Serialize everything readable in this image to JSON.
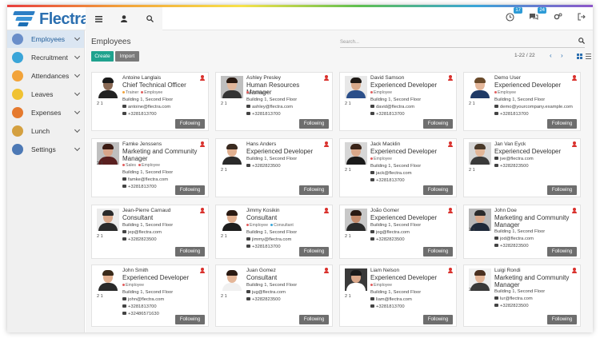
{
  "app": {
    "name": "Flectra"
  },
  "topbar": {
    "badges": {
      "activities": "17",
      "messages": "24"
    }
  },
  "sidebar": {
    "items": [
      {
        "label": "Employees",
        "color": "#6a8ec9"
      },
      {
        "label": "Recruitment",
        "color": "#3aa5d8"
      },
      {
        "label": "Attendances",
        "color": "#f2a33a"
      },
      {
        "label": "Leaves",
        "color": "#f0c232"
      },
      {
        "label": "Expenses",
        "color": "#e57a2e"
      },
      {
        "label": "Lunch",
        "color": "#d4a040"
      },
      {
        "label": "Settings",
        "color": "#4d79b5"
      }
    ]
  },
  "main": {
    "title": "Employees",
    "search_placeholder": "Search...",
    "create_label": "Create",
    "import_label": "Import",
    "pager": "1-22 / 22",
    "follow_label": "Following"
  },
  "accent": {
    "primary": "#1fa28e",
    "link": "#2b6fb0",
    "alert": "#d9302c"
  },
  "employees": [
    {
      "name": "Antoine Langlais",
      "title": "Chief Technical Officer",
      "tags": [
        [
          "Trainer",
          "#f2a33a"
        ],
        [
          "Employee",
          "#e05d5d"
        ]
      ],
      "building": "Building 1, Second Floor",
      "email": "antoine@flectra.com",
      "phone": "+3281813700",
      "extra": "",
      "stats": "2  1",
      "skin": "#8a6a55",
      "hair": "#1a1a1a",
      "shirt": "#222",
      "bg": "#ffffff"
    },
    {
      "name": "Ashley Presley",
      "title": "Human Resources Manager",
      "tags": [
        [
          "Employee",
          "#e05d5d"
        ]
      ],
      "building": "Building 1, Second Floor",
      "email": "ashley@flectra.com",
      "phone": "+3281813700",
      "extra": "",
      "stats": "2  1",
      "skin": "#e1b69a",
      "hair": "#2a1a12",
      "shirt": "#333",
      "bg": "#bfbfbf"
    },
    {
      "name": "David Samson",
      "title": "Experienced Developer",
      "tags": [
        [
          "Employee",
          "#e05d5d"
        ]
      ],
      "building": "Building 1, Second Floor",
      "email": "david@flectra.com",
      "phone": "+3281813700",
      "extra": "",
      "stats": "2  1",
      "skin": "#d7a98a",
      "hair": "#1f1a16",
      "shirt": "#2b4f8a",
      "bg": "#e8e8e8"
    },
    {
      "name": "Demo User",
      "title": "Experienced Developer",
      "tags": [
        [
          "Employee",
          "#e05d5d"
        ]
      ],
      "building": "Building 1, Second Floor",
      "email": "demo@yourcompany.example.com",
      "phone": "+3281813700",
      "extra": "",
      "stats": "2  1",
      "skin": "#e4b79a",
      "hair": "#6a4a2a",
      "shirt": "#1f3a66",
      "bg": "#ffffff"
    },
    {
      "name": "Famke Jenssens",
      "title": "Marketing and Community Manager",
      "tags": [
        [
          "Sales",
          "#e05d5d"
        ],
        [
          "Employee",
          "#e05d5d"
        ]
      ],
      "building": "Building 1, Second Floor",
      "email": "famke@flectra.com",
      "phone": "+3281813700",
      "extra": "",
      "stats": "2  1",
      "skin": "#d8a58a",
      "hair": "#3a1a12",
      "shirt": "#5a2020",
      "bg": "#bfbfbf"
    },
    {
      "name": "Hans Anders",
      "title": "Experienced Developer",
      "tags": [],
      "building": "Building 1, Second Floor",
      "email": "",
      "phone": "+3282823500",
      "extra": "",
      "stats": "2  1",
      "skin": "#e1b090",
      "hair": "#3a2a20",
      "shirt": "#2a2a2a",
      "bg": "#ffffff"
    },
    {
      "name": "Jack Macklin",
      "title": "Experienced Developer",
      "tags": [
        [
          "Employee",
          "#e05d5d"
        ]
      ],
      "building": "Building 1, Second Floor",
      "email": "jack@flectra.com",
      "phone": "+3281813700",
      "extra": "",
      "stats": "2  1",
      "skin": "#d9a88a",
      "hair": "#3a2418",
      "shirt": "#1a1a1a",
      "bg": "#d6d6d6"
    },
    {
      "name": "Jan Van Eyck",
      "title": "Experienced Developer",
      "tags": [],
      "building": "",
      "email": "jve@flectra.com",
      "phone": "+3282823500",
      "extra": "",
      "stats": "2  1",
      "skin": "#e2b698",
      "hair": "#4a3a2a",
      "shirt": "#3a3a3a",
      "bg": "#d8d8d8"
    },
    {
      "name": "Jean-Pierre Carnaud",
      "title": "Consultant",
      "tags": [],
      "building": "Building 1, Second Floor",
      "email": "jep@flectra.com",
      "phone": "+3282823500",
      "extra": "",
      "stats": "2  1",
      "skin": "#d9a88a",
      "hair": "#2a2a2a",
      "shirt": "#2a2a2a",
      "bg": "#ececec"
    },
    {
      "name": "Jimmy Kosikin",
      "title": "Consultant",
      "tags": [
        [
          "Employee",
          "#e05d5d"
        ],
        [
          "Consultant",
          "#3aa5d8"
        ]
      ],
      "building": "Building 1, Second Floor",
      "email": "jimmy@flectra.com",
      "phone": "+3281813700",
      "extra": "",
      "stats": "2  1",
      "skin": "#e1b090",
      "hair": "#2a1a12",
      "shirt": "#1e1e1e",
      "bg": "#ffffff"
    },
    {
      "name": "João Gomer",
      "title": "Experienced Developer",
      "tags": [],
      "building": "Building 1, Second Floor",
      "email": "jog@flectra.com",
      "phone": "+3282823500",
      "extra": "",
      "stats": "2  1",
      "skin": "#c48a6a",
      "hair": "#2a1a12",
      "shirt": "#2a2a2a",
      "bg": "#c8c8c8"
    },
    {
      "name": "John Doe",
      "title": "Marketing and Community Manager",
      "tags": [],
      "building": "Building 1, Second Floor",
      "email": "jod@flectra.com",
      "phone": "+3282823500",
      "extra": "",
      "stats": "2  1",
      "skin": "#d9a88a",
      "hair": "#2a2a2a",
      "shirt": "#1f2a3a",
      "bg": "#b8b8b8"
    },
    {
      "name": "John Smith",
      "title": "Experienced Developer",
      "tags": [
        [
          "Employee",
          "#e05d5d"
        ]
      ],
      "building": "Building 1, Second Floor",
      "email": "john@flectra.com",
      "phone": "+3281813700",
      "extra": "+32486571630",
      "stats": "2  1",
      "skin": "#e1b090",
      "hair": "#3a2a1a",
      "shirt": "#2a2a2a",
      "bg": "#ffffff"
    },
    {
      "name": "Juan Gomez",
      "title": "Consultant",
      "tags": [],
      "building": "Building 1, Second Floor",
      "email": "jug@flectra.com",
      "phone": "+3282823500",
      "extra": "",
      "stats": "2  1",
      "skin": "#e4b698",
      "hair": "#2a1a12",
      "shirt": "#f0f0f0",
      "bg": "#ffffff"
    },
    {
      "name": "Liam Nelson",
      "title": "Experienced Developer",
      "tags": [
        [
          "Employee",
          "#e05d5d"
        ]
      ],
      "building": "Building 1, Second Floor",
      "email": "liam@flectra.com",
      "phone": "+3281813700",
      "extra": "",
      "stats": "2  1",
      "skin": "#dba88a",
      "hair": "#1a1a1a",
      "shirt": "#ffffff",
      "bg": "#3a3a3a"
    },
    {
      "name": "Luigi Rondi",
      "title": "Marketing and Community Manager",
      "tags": [],
      "building": "Building 1, Second Floor",
      "email": "lur@flectra.com",
      "phone": "+3282823500",
      "extra": "",
      "stats": "2  1",
      "skin": "#e4b698",
      "hair": "#4a3020",
      "shirt": "#3a3a3a",
      "bg": "#f0f0f0"
    }
  ]
}
